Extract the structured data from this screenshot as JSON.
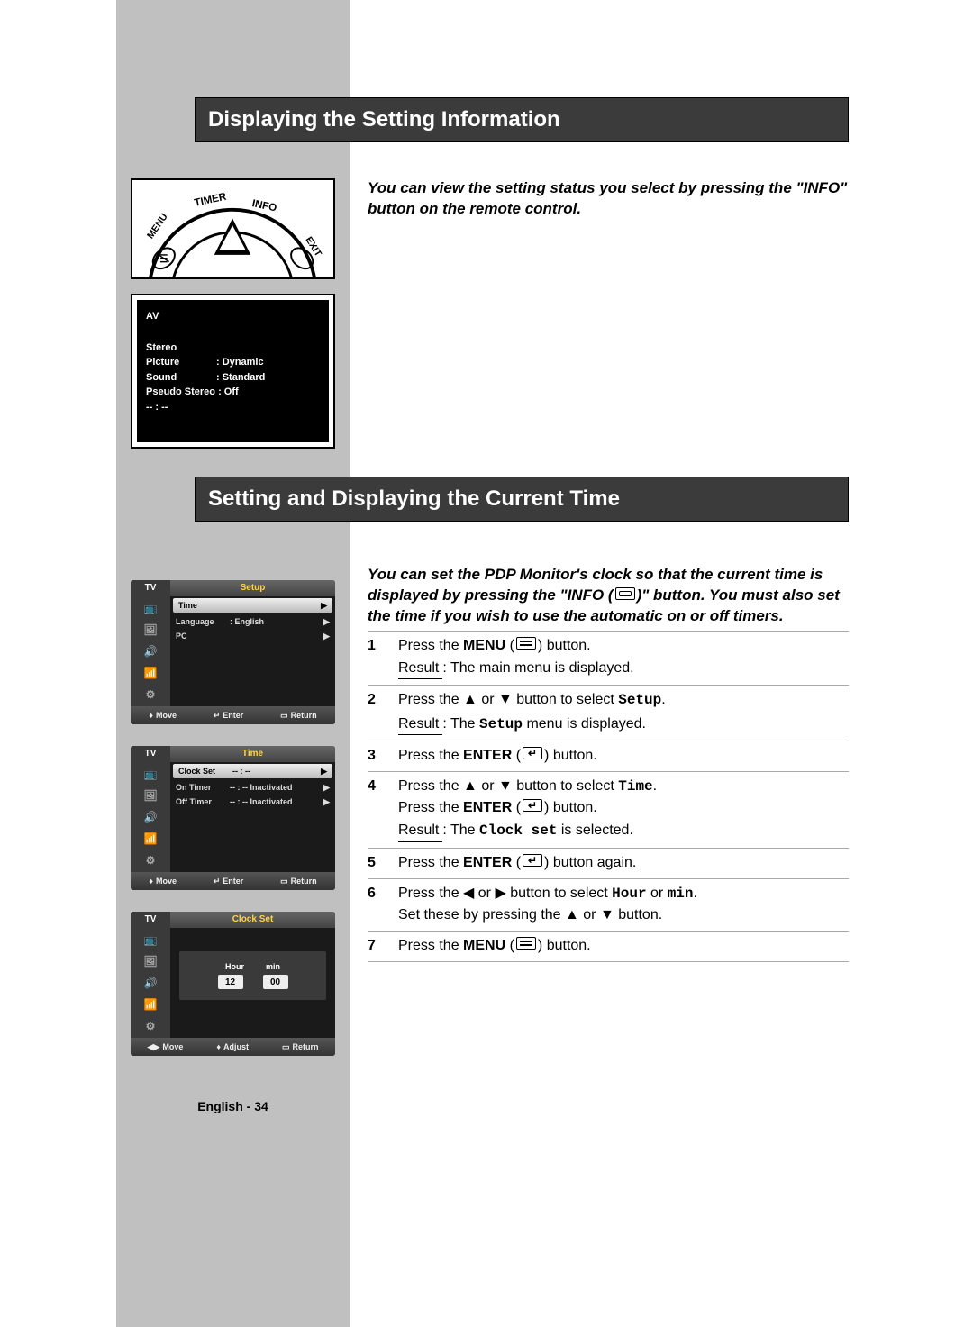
{
  "titles": {
    "section1": "Displaying the Setting Information",
    "section2": "Setting and Displaying the Current Time"
  },
  "intro": {
    "section1": "You can view the setting status you select by pressing the \"INFO\" button on the remote control.",
    "section2": "You can set the PDP Monitor's clock so that the current time is displayed by pressing the \"INFO ( )\" button. You must also set the time if you wish to use the automatic on or off timers."
  },
  "remote": {
    "labels": {
      "timer": "TIMER",
      "info": "INFO",
      "menu": "MENU",
      "exit": "EXIT"
    }
  },
  "info_osd": {
    "source": "AV",
    "audio": "Stereo",
    "picture_k": "Picture",
    "picture_v": ": Dynamic",
    "sound_k": "Sound",
    "sound_v": ": Standard",
    "pseudo": "Pseudo Stereo : Off",
    "time": "-- : --"
  },
  "osd": {
    "tv": "TV",
    "setup": {
      "title": "Setup",
      "rows": [
        {
          "k": "Time",
          "v": "",
          "sel": true,
          "arrow": "▶"
        },
        {
          "k": "Language",
          "v": ": English",
          "arrow": "▶"
        },
        {
          "k": "PC",
          "v": "",
          "arrow": "▶"
        }
      ],
      "footer": {
        "move": "Move",
        "enter": "Enter",
        "return": "Return"
      }
    },
    "time": {
      "title": "Time",
      "rows": [
        {
          "k": "Clock Set",
          "v": "-- : --",
          "sel": true,
          "arrow": "▶"
        },
        {
          "k": "On Timer",
          "v": "-- : --   Inactivated",
          "arrow": "▶"
        },
        {
          "k": "Off Timer",
          "v": "-- : --   Inactivated",
          "arrow": "▶"
        }
      ],
      "footer": {
        "move": "Move",
        "enter": "Enter",
        "return": "Return"
      }
    },
    "clockset": {
      "title": "Clock Set",
      "hour_lab": "Hour",
      "min_lab": "min",
      "hour_val": "12",
      "min_val": "00",
      "footer": {
        "move": "Move",
        "adjust": "Adjust",
        "return": "Return"
      }
    }
  },
  "steps": {
    "result_label": "Result",
    "items": [
      {
        "num": "1",
        "parts": [
          {
            "t": "Press the "
          },
          {
            "t": "MENU",
            "b": true
          },
          {
            "t": " ("
          },
          {
            "icon": "menu"
          },
          {
            "t": ") button."
          }
        ],
        "result": "The main menu is displayed."
      },
      {
        "num": "2",
        "parts": [
          {
            "t": "Press the ▲ or ▼ button to select "
          },
          {
            "t": "Setup",
            "mono": true
          },
          {
            "t": "."
          }
        ],
        "result_parts": [
          {
            "t": "The "
          },
          {
            "t": "Setup",
            "mono": true
          },
          {
            "t": " menu is displayed."
          }
        ]
      },
      {
        "num": "3",
        "parts": [
          {
            "t": "Press the "
          },
          {
            "t": "ENTER",
            "b": true
          },
          {
            "t": " ("
          },
          {
            "icon": "enter"
          },
          {
            "t": ") button."
          }
        ]
      },
      {
        "num": "4",
        "lines": [
          [
            {
              "t": "Press the ▲ or ▼ button to select "
            },
            {
              "t": "Time",
              "mono": true
            },
            {
              "t": "."
            }
          ],
          [
            {
              "t": "Press the "
            },
            {
              "t": "ENTER",
              "b": true
            },
            {
              "t": " ("
            },
            {
              "icon": "enter"
            },
            {
              "t": ") button."
            }
          ]
        ],
        "result_parts": [
          {
            "t": "The "
          },
          {
            "t": "Clock set",
            "mono": true
          },
          {
            "t": " is selected."
          }
        ]
      },
      {
        "num": "5",
        "parts": [
          {
            "t": "Press the "
          },
          {
            "t": "ENTER",
            "b": true
          },
          {
            "t": " ("
          },
          {
            "icon": "enter"
          },
          {
            "t": ") button again."
          }
        ]
      },
      {
        "num": "6",
        "lines": [
          [
            {
              "t": "Press the ◀ or ▶ button to select "
            },
            {
              "t": "Hour",
              "mono": true
            },
            {
              "t": " or "
            },
            {
              "t": "min",
              "mono": true
            },
            {
              "t": "."
            }
          ],
          [
            {
              "t": "Set these by pressing the ▲ or ▼ button."
            }
          ]
        ]
      },
      {
        "num": "7",
        "parts": [
          {
            "t": "Press the "
          },
          {
            "t": "MENU",
            "b": true
          },
          {
            "t": " ("
          },
          {
            "icon": "menu"
          },
          {
            "t": ") button."
          }
        ]
      }
    ]
  },
  "page_number": "English - 34"
}
